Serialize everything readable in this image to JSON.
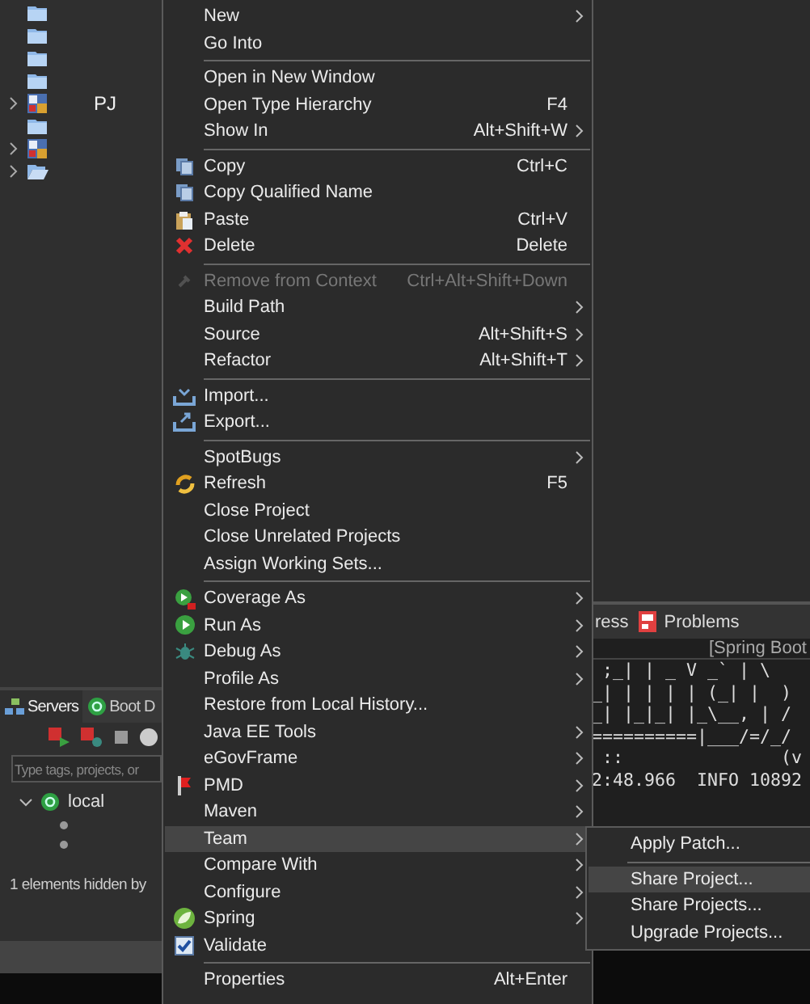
{
  "explorer": {
    "rows": [
      {
        "kind": "folder"
      },
      {
        "kind": "folder"
      },
      {
        "kind": "folder"
      },
      {
        "kind": "folder"
      },
      {
        "kind": "project",
        "expanded": false,
        "label": "PJ"
      },
      {
        "kind": "folder"
      },
      {
        "kind": "project",
        "expanded": false
      },
      {
        "kind": "open-folder",
        "expanded": false
      }
    ]
  },
  "servers_panel": {
    "tabs": [
      {
        "label": "Servers",
        "selected": true
      },
      {
        "label": "Boot D",
        "selected": false
      }
    ],
    "search": {
      "placeholder": "Type tags, projects, or"
    },
    "tree": [
      {
        "label": "local",
        "expanded": true,
        "children": [
          {
            "kind": "bullet"
          },
          {
            "kind": "bullet"
          }
        ]
      }
    ],
    "status": "1 elements hidden by"
  },
  "console": {
    "tabs": [
      {
        "label": "ress",
        "selected": false
      },
      {
        "label": "Problems",
        "selected": false
      }
    ],
    "title": "[Spring Boot",
    "lines": [
      " ;_| | _ V _` | \\",
      "_| | | | | (_| |  )",
      "_| |_|_| |_\\__, | /",
      "==========|___/=/_/",
      " ::               (v",
      "2:48.966  INFO 10892"
    ]
  },
  "context_menu": {
    "items": [
      {
        "kind": "item",
        "label": "New",
        "submenu": true
      },
      {
        "kind": "item",
        "label": "Go Into"
      },
      {
        "kind": "separator"
      },
      {
        "kind": "item",
        "label": "Open in New Window"
      },
      {
        "kind": "item",
        "label": "Open Type Hierarchy",
        "shortcut": "F4"
      },
      {
        "kind": "item",
        "label": "Show In",
        "shortcut": "Alt+Shift+W",
        "submenu": true
      },
      {
        "kind": "separator"
      },
      {
        "kind": "item",
        "label": "Copy",
        "shortcut": "Ctrl+C"
      },
      {
        "kind": "item",
        "label": "Copy Qualified Name"
      },
      {
        "kind": "item",
        "label": "Paste",
        "shortcut": "Ctrl+V"
      },
      {
        "kind": "item",
        "label": "Delete",
        "shortcut": "Delete"
      },
      {
        "kind": "separator"
      },
      {
        "kind": "item",
        "label": "Remove from Context",
        "shortcut": "Ctrl+Alt+Shift+Down",
        "disabled": true
      },
      {
        "kind": "item",
        "label": "Build Path",
        "submenu": true
      },
      {
        "kind": "item",
        "label": "Source",
        "shortcut": "Alt+Shift+S",
        "submenu": true
      },
      {
        "kind": "item",
        "label": "Refactor",
        "shortcut": "Alt+Shift+T",
        "submenu": true
      },
      {
        "kind": "separator"
      },
      {
        "kind": "item",
        "label": "Import..."
      },
      {
        "kind": "item",
        "label": "Export..."
      },
      {
        "kind": "separator"
      },
      {
        "kind": "item",
        "label": "SpotBugs",
        "submenu": true
      },
      {
        "kind": "item",
        "label": "Refresh",
        "shortcut": "F5"
      },
      {
        "kind": "item",
        "label": "Close Project"
      },
      {
        "kind": "item",
        "label": "Close Unrelated Projects"
      },
      {
        "kind": "item",
        "label": "Assign Working Sets..."
      },
      {
        "kind": "separator"
      },
      {
        "kind": "item",
        "label": "Coverage As",
        "submenu": true
      },
      {
        "kind": "item",
        "label": "Run As",
        "submenu": true
      },
      {
        "kind": "item",
        "label": "Debug As",
        "submenu": true
      },
      {
        "kind": "item",
        "label": "Profile As",
        "submenu": true
      },
      {
        "kind": "item",
        "label": "Restore from Local History..."
      },
      {
        "kind": "item",
        "label": "Java EE Tools",
        "submenu": true
      },
      {
        "kind": "item",
        "label": "eGovFrame",
        "submenu": true
      },
      {
        "kind": "item",
        "label": "PMD",
        "submenu": true
      },
      {
        "kind": "item",
        "label": "Maven",
        "submenu": true
      },
      {
        "kind": "item",
        "label": "Team",
        "submenu": true,
        "selected": true
      },
      {
        "kind": "item",
        "label": "Compare With",
        "submenu": true
      },
      {
        "kind": "item",
        "label": "Configure",
        "submenu": true
      },
      {
        "kind": "item",
        "label": "Spring",
        "submenu": true
      },
      {
        "kind": "item",
        "label": "Validate"
      },
      {
        "kind": "separator"
      },
      {
        "kind": "item",
        "label": "Properties",
        "shortcut": "Alt+Enter"
      }
    ]
  },
  "team_submenu": {
    "items": [
      {
        "kind": "item",
        "label": "Apply Patch..."
      },
      {
        "kind": "separator"
      },
      {
        "kind": "item",
        "label": "Share Project...",
        "selected": true
      },
      {
        "kind": "item",
        "label": "Share Projects..."
      },
      {
        "kind": "item",
        "label": "Upgrade Projects..."
      }
    ]
  }
}
